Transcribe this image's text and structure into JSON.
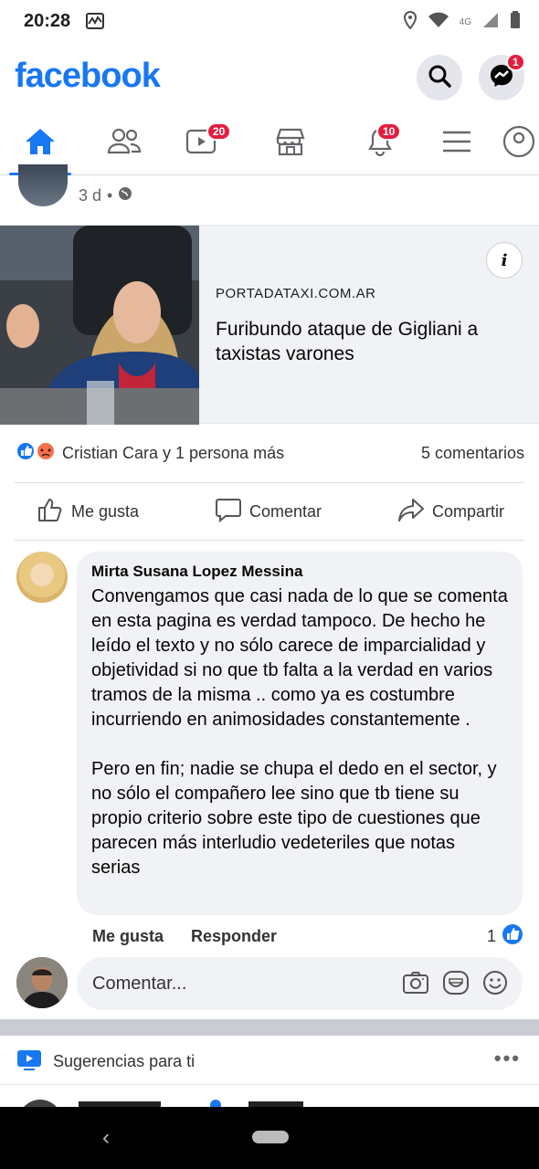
{
  "status": {
    "time": "20:28",
    "network": "4G"
  },
  "header": {
    "logo": "facebook",
    "messenger_badge": "1"
  },
  "nav": {
    "watch_badge": "20",
    "notifications_badge": "10"
  },
  "post": {
    "age": "3 d",
    "link": {
      "domain": "PORTADATAXI.COM.AR",
      "title": "Furibundo ataque de Gigliani a taxistas varones",
      "info": "i"
    },
    "reactions_text": "Cristian Cara y 1 persona más",
    "comments_count": "5 comentarios",
    "actions": {
      "like": "Me gusta",
      "comment": "Comentar",
      "share": "Compartir"
    }
  },
  "comment": {
    "author": "Mirta Susana Lopez Messina",
    "text": "Convengamos que casi nada de lo que se comenta en esta pagina es verdad tampoco. De hecho he leído el texto y no sólo carece de imparcialidad y objetividad si no que tb falta a la verdad en varios tramos de la misma .. como ya es costumbre incurriendo en animosidades constantemente .\n\nPero en fin; nadie se chupa el dedo en el sector, y no sólo el compañero lee sino que tb tiene su propio criterio sobre este tipo de cuestiones que parecen más interludio vedeteriles que notas serias",
    "like_label": "Me gusta",
    "reply_label": "Responder",
    "like_count": "1"
  },
  "composer": {
    "placeholder": "Comentar..."
  },
  "suggestions": {
    "label": "Sugerencias para ti",
    "more": "•••"
  },
  "colors": {
    "brand": "#1877f2",
    "badge": "#e41e3f",
    "bubble": "#f0f2f5"
  }
}
